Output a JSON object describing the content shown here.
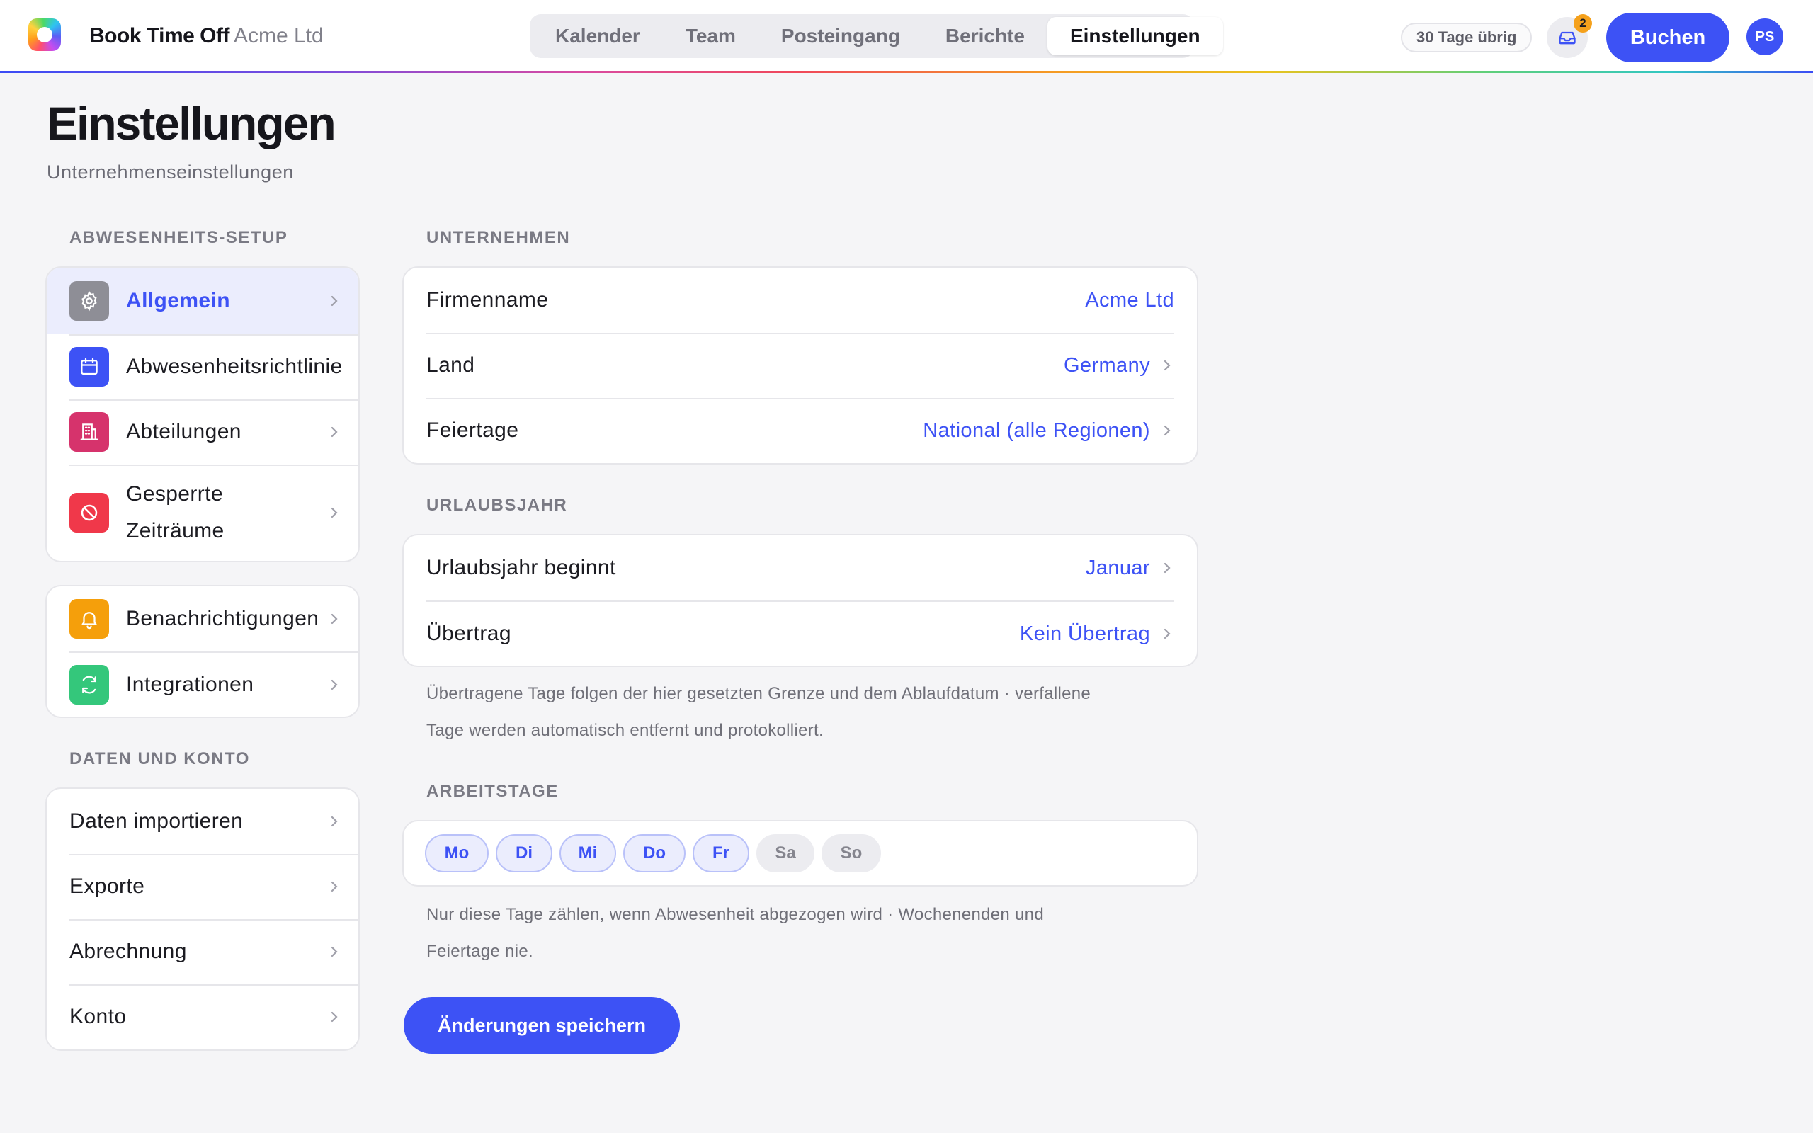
{
  "app": {
    "brand": "Book Time Off",
    "org": "Acme Ltd"
  },
  "nav": {
    "tabs": [
      {
        "label": "Kalender"
      },
      {
        "label": "Team"
      },
      {
        "label": "Posteingang"
      },
      {
        "label": "Berichte"
      },
      {
        "label": "Einstellungen",
        "active": true
      }
    ]
  },
  "header": {
    "days_left": "30 Tage übrig",
    "inbox_count": "2",
    "book_label": "Buchen",
    "avatar_initials": "PS"
  },
  "page": {
    "title": "Einstellungen",
    "subtitle": "Unternehmenseinstellungen"
  },
  "sidebar": {
    "setup_label": "ABWESENHEITS-SETUP",
    "setup_items": [
      {
        "label": "Allgemein",
        "icon": "gear-icon",
        "color": "#8e8e96",
        "active": true
      },
      {
        "label": "Abwesenheitsrichtlinien",
        "icon": "calendar-icon",
        "color": "#3d52f5"
      },
      {
        "label": "Abteilungen",
        "icon": "building-icon",
        "color": "#d6336c"
      },
      {
        "label": "Gesperrte Zeiträume",
        "icon": "block-icon",
        "color": "#f0384a"
      }
    ],
    "extra_items": [
      {
        "label": "Benachrichtigungen",
        "icon": "bell-icon",
        "color": "#f59f0b"
      },
      {
        "label": "Integrationen",
        "icon": "sync-icon",
        "color": "#34c77b"
      }
    ],
    "data_label": "DATEN UND KONTO",
    "data_items": [
      {
        "label": "Daten importieren"
      },
      {
        "label": "Exporte"
      },
      {
        "label": "Abrechnung"
      },
      {
        "label": "Konto"
      }
    ]
  },
  "company": {
    "section_label": "UNTERNEHMEN",
    "rows": [
      {
        "label": "Firmenname",
        "value": "Acme Ltd"
      },
      {
        "label": "Land",
        "value": "Germany"
      },
      {
        "label": "Feiertage",
        "value": "National (alle Regionen)"
      }
    ]
  },
  "leave_year": {
    "section_label": "URLAUBSJAHR",
    "rows": [
      {
        "label": "Urlaubsjahr beginnt",
        "value": "Januar"
      },
      {
        "label": "Übertrag",
        "value": "Kein Übertrag"
      }
    ],
    "hint": "Übertragene Tage folgen der hier gesetzten Grenze und dem Ablaufdatum · verfallene Tage werden automatisch entfernt und protokolliert."
  },
  "workdays": {
    "section_label": "ARBEITSTAGE",
    "days": [
      {
        "label": "Mo",
        "active": true
      },
      {
        "label": "Di",
        "active": true
      },
      {
        "label": "Mi",
        "active": true
      },
      {
        "label": "Do",
        "active": true
      },
      {
        "label": "Fr",
        "active": true
      },
      {
        "label": "Sa",
        "active": false
      },
      {
        "label": "So",
        "active": false
      }
    ],
    "hint": "Nur diese Tage zählen, wenn Abwesenheit abgezogen wird · Wochenenden und Feiertage nie."
  },
  "actions": {
    "save_label": "Änderungen speichern"
  },
  "colors": {
    "accent": "#3d52f5",
    "accent_soft": "#ebedfd",
    "badge": "#f5a11c"
  }
}
